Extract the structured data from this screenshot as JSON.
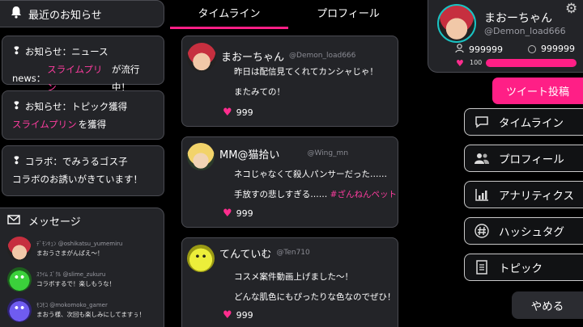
{
  "news": {
    "title": "最近のお知らせ",
    "items": [
      {
        "prefix": "お知らせ：ニュース",
        "line2_pre": "news：",
        "highlight": "スライムプリン",
        "line2_post": "が流行中！"
      },
      {
        "prefix": "お知らせ：トピック獲得",
        "highlight": "スライムプリン",
        "line2_post": "を獲得"
      },
      {
        "prefix": "コラボ：でみうるゴス子",
        "line2_post": "コラボのお誘いがきています！"
      }
    ]
  },
  "messages": {
    "title": "メッセージ",
    "items": [
      {
        "meta": "ﾃﾞﾓﾝｷｭﾝ @oshikatsu_yumemiru",
        "body": "まおうさまがんばえ～！"
      },
      {
        "meta": "ｽﾗｲﾑ ｽﾞｸﾙ @slime_zukuru",
        "body": "コラボするで！楽しもうな！"
      },
      {
        "meta": "ﾓｺﾓｺ @mokomoko_gamer",
        "body": "まおう様、次回も楽しみにしてますぅ！"
      }
    ]
  },
  "tabs": {
    "timeline": "タイムライン",
    "profile": "プロフィール"
  },
  "posts": [
    {
      "name": "まおーちゃん",
      "handle": "@Demon_load666",
      "lines": [
        "昨日は配信見てくれてカンシャじゃ！",
        "またみての！"
      ],
      "tag": "",
      "likes": "999"
    },
    {
      "name": "MM@猫拾い",
      "handle": "@Wing_mn",
      "lines": [
        "ネコじゃなくて殺人パンサーだった……",
        "手放すの悲しすぎる……"
      ],
      "tag": "#ざんねんペット",
      "likes": "999"
    },
    {
      "name": "てんていむ",
      "handle": "@Ten710",
      "lines": [
        "コスメ案件動画上げました～！",
        "どんな肌色にもぴったりな色なのでぜひ！"
      ],
      "tag": "",
      "likes": "999"
    }
  ],
  "profile": {
    "name": "まおーちゃん",
    "handle": "@Demon_load666",
    "followers": "999999",
    "coins": "999999",
    "hp_value": "100",
    "hp_fraction": 1.0
  },
  "actions": {
    "tweet": "ツイート投稿",
    "nav": [
      {
        "label": "タイムライン",
        "icon": "speech-bubble-icon"
      },
      {
        "label": "プロフィール",
        "icon": "users-icon"
      },
      {
        "label": "アナリティクス",
        "icon": "bar-chart-icon"
      },
      {
        "label": "ハッシュタグ",
        "icon": "hashtag-icon"
      },
      {
        "label": "トピック",
        "icon": "document-icon"
      }
    ],
    "quit": "やめる"
  },
  "colors": {
    "accent": "#ff1f86",
    "panel": "#232428"
  }
}
